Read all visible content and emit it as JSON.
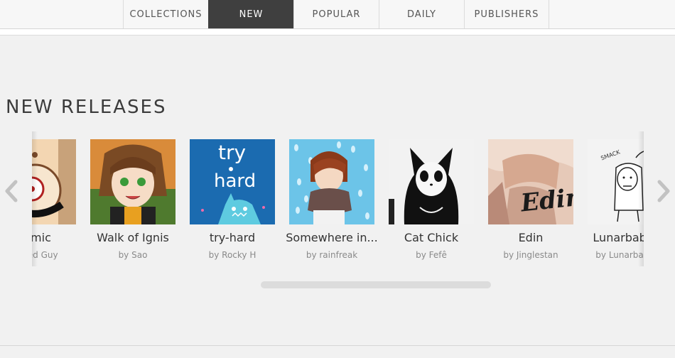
{
  "nav": {
    "tabs": [
      {
        "label": "COLLECTIONS",
        "active": false
      },
      {
        "label": "NEW",
        "active": true
      },
      {
        "label": "POPULAR",
        "active": false
      },
      {
        "label": "DAILY",
        "active": false
      },
      {
        "label": "PUBLISHERS",
        "active": false
      }
    ]
  },
  "section": {
    "title": "NEW RELEASES"
  },
  "carousel": {
    "items": [
      {
        "title": "Comic",
        "author": "by Red Guy",
        "cover_icon": "comic-cover"
      },
      {
        "title": "Walk of Ignis",
        "author": "by Sao",
        "cover_icon": "walk-of-ignis-cover"
      },
      {
        "title": "try-hard",
        "author": "by Rocky H",
        "cover_icon": "try-hard-cover",
        "cover_text": [
          "try",
          "hard"
        ]
      },
      {
        "title": "Somewhere in...",
        "author": "by rainfreak",
        "cover_icon": "somewhere-cover"
      },
      {
        "title": "Cat Chick",
        "author": "by Fefê",
        "cover_icon": "cat-chick-cover"
      },
      {
        "title": "Edin",
        "author": "by Jinglestan",
        "cover_icon": "edin-cover",
        "cover_text": [
          "Edin"
        ]
      },
      {
        "title": "Lunarbaboon",
        "author": "by Lunarbaboon",
        "cover_icon": "lunarbaboon-cover",
        "cover_text": [
          "SMACK"
        ]
      }
    ],
    "prev_icon": "chevron-left-icon",
    "next_icon": "chevron-right-icon"
  },
  "colors": {
    "active_tab": "#3f3f3f",
    "page_bg": "#f1f1f1",
    "try_hard_bg": "#1b6bb0"
  }
}
